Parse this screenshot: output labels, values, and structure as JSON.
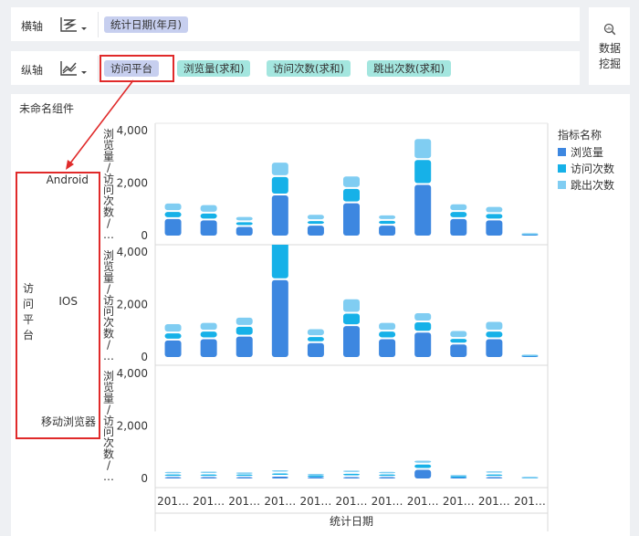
{
  "x_axis": {
    "label": "横轴",
    "icon": "chart-axis-icon",
    "fields": [
      {
        "label": "统计日期(年月)",
        "kind": "dimension"
      }
    ]
  },
  "y_axis": {
    "label": "纵轴",
    "icon": "line-chart-icon",
    "fields": [
      {
        "label": "访问平台",
        "kind": "dimension"
      },
      {
        "label": "浏览量(求和)",
        "kind": "measure"
      },
      {
        "label": "访问次数(求和)",
        "kind": "measure"
      },
      {
        "label": "跳出次数(求和)",
        "kind": "measure"
      }
    ]
  },
  "data_mining": {
    "label": "数据挖掘",
    "icon": "magnifier-chart-icon"
  },
  "component": {
    "title": "未命名组件"
  },
  "colors": {
    "pv": "#3d87e0",
    "visits": "#16b1e8",
    "bounce": "#80cdf2",
    "dimension_pill": "#c7cfef",
    "measure_pill": "#a4e6df",
    "highlight": "#e02a2a"
  },
  "chart_data": {
    "type": "bar",
    "stacked": true,
    "row_dimension": "访问平台",
    "row_dimension_chars": [
      "访",
      "问",
      "平",
      "台"
    ],
    "rows": [
      "Android",
      "IOS",
      "移动浏览器"
    ],
    "y_axis_label_chars": [
      "浏",
      "览",
      "量",
      "/",
      "访",
      "问",
      "次",
      "数",
      "/",
      "…"
    ],
    "y_ticks": [
      "4,000",
      "2,000",
      "0"
    ],
    "ylim": [
      0,
      4000
    ],
    "x_title": "统计日期",
    "categories": [
      "201…",
      "201…",
      "201…",
      "201…",
      "201…",
      "201…",
      "201…",
      "201…",
      "201…",
      "201…",
      "201…"
    ],
    "legend_title": "指标名称",
    "legend_items": [
      "浏览量",
      "访问次数",
      "跳出次数"
    ],
    "series": [
      {
        "name": "浏览量",
        "values": {
          "Android": [
            700,
            650,
            400,
            1600,
            450,
            1300,
            450,
            2000,
            700,
            650,
            25
          ],
          "IOS": [
            700,
            750,
            850,
            3000,
            600,
            1250,
            750,
            1000,
            550,
            750,
            25
          ],
          "移动浏览器": [
            100,
            100,
            100,
            140,
            60,
            120,
            100,
            400,
            40,
            100,
            5
          ]
        }
      },
      {
        "name": "访问次数",
        "values": {
          "Android": [
            270,
            260,
            180,
            700,
            170,
            550,
            180,
            950,
            270,
            240,
            15
          ],
          "IOS": [
            270,
            290,
            370,
            1500,
            230,
            470,
            290,
            390,
            210,
            290,
            15
          ],
          "移动浏览器": [
            100,
            110,
            80,
            120,
            60,
            130,
            100,
            200,
            40,
            120,
            5
          ]
        }
      },
      {
        "name": "跳出次数",
        "values": {
          "Android": [
            320,
            320,
            200,
            550,
            240,
            470,
            210,
            800,
            290,
            270,
            20
          ],
          "IOS": [
            350,
            330,
            350,
            700,
            300,
            550,
            330,
            350,
            300,
            370,
            20
          ],
          "移动浏览器": [
            80,
            90,
            60,
            100,
            50,
            100,
            80,
            150,
            30,
            80,
            5
          ]
        }
      }
    ]
  }
}
